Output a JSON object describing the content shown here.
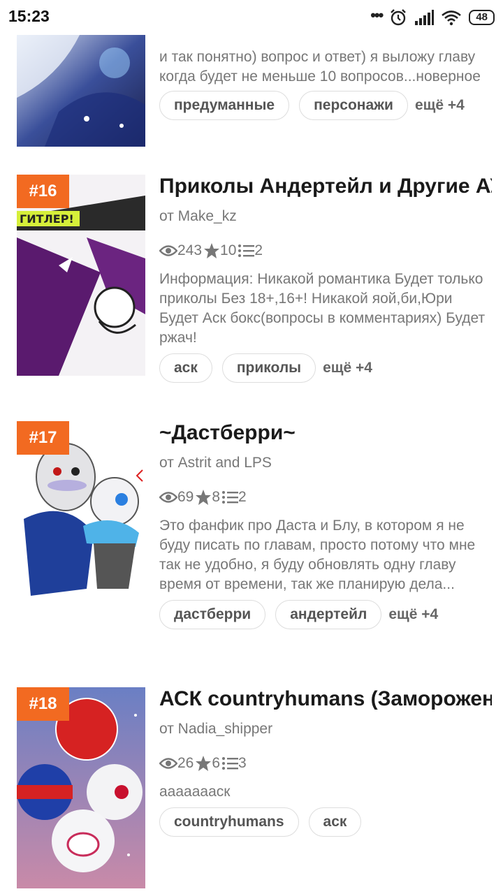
{
  "status_bar": {
    "time": "15:23",
    "battery": "48",
    "dots": "•••"
  },
  "cards": [
    {
      "description": "и так понятно) вопрос и ответ) я выложу главу когда будет не меньше 10 вопросов...новерное",
      "tags": [
        "предуманные",
        "персонажи"
      ],
      "more": "ещё +4"
    },
    {
      "rank": "#16",
      "title": "Приколы Андертейл и Другие АУ",
      "author": "от Make_kz",
      "views": "243",
      "stars": "10",
      "chapters": "2",
      "description": "Информация: Никакой романтика Будет только приколы Без 18+,16+! Никакой яой,би,Юри Будет Аск бокс(вопросы в комментариях) Будет ржач!",
      "tags": [
        "аск",
        "приколы"
      ],
      "more": "ещё +4",
      "cover_text": "ГИТЛЕР!"
    },
    {
      "rank": "#17",
      "title": "~Дастберри~",
      "author": "от Astrit and LPS",
      "views": "69",
      "stars": "8",
      "chapters": "2",
      "description": "Это фанфик про Даста и Блу, в котором я не буду писать по главам, просто потому что мне так не удобно, я буду обновлять одну главу время от времени, так же планирую дела...",
      "tags": [
        "дастберри",
        "андертейл"
      ],
      "more": "ещё +4"
    },
    {
      "rank": "#18",
      "title": "АСК countryhumans (Заморожен)",
      "author": "от Nadia_shipper",
      "views": "26",
      "stars": "6",
      "chapters": "3",
      "description": "аааааааск",
      "tags": [
        "countryhumans",
        "аск"
      ]
    }
  ]
}
